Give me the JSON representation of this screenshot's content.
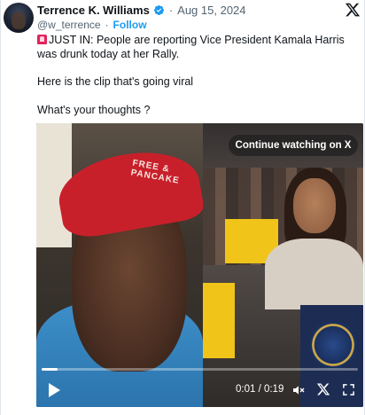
{
  "author": {
    "name": "Terrence K. Williams",
    "handle": "@w_terrence",
    "verified": true,
    "date": "Aug 15, 2024",
    "separator": "·",
    "follow_label": "Follow"
  },
  "tweet": {
    "line1": "JUST IN: People are reporting Vice President Kamala Harris was drunk today at her Rally.",
    "line2": "Here is the clip that's going viral",
    "line3": "What's your thoughts ?"
  },
  "video": {
    "overlay_label": "Continue watching on X",
    "time": "0:01 / 0:19",
    "progress": 0.05,
    "hat_text": "FREE & PANCAKE"
  },
  "colors": {
    "accent": "#1d9bf0",
    "verified": "#1d9bf0",
    "text": "#0f1419",
    "muted": "#536471"
  },
  "icons": [
    "avatar",
    "verified-badge-icon",
    "x-logo-icon",
    "siren-emoji-icon",
    "play-icon",
    "volume-icon",
    "x-icon",
    "fullscreen-icon"
  ]
}
